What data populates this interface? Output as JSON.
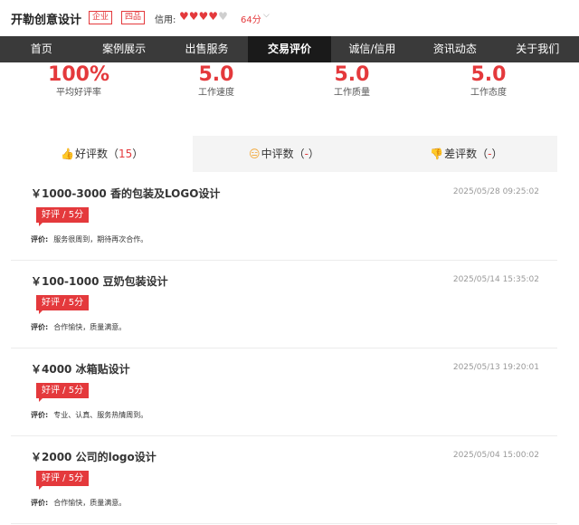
{
  "header": {
    "shop_name": "开勒创意设计",
    "tags": [
      "企业",
      "四品"
    ],
    "credit_label": "信用:",
    "hearts_on": 4,
    "hearts_total": 5,
    "score": "64分"
  },
  "nav": {
    "items": [
      "首页",
      "案例展示",
      "出售服务",
      "交易评价",
      "诚信/信用",
      "资讯动态",
      "关于我们"
    ],
    "active_index": 3
  },
  "stats": [
    {
      "value": "100%",
      "label": "平均好评率"
    },
    {
      "value": "5.0",
      "label": "工作速度"
    },
    {
      "value": "5.0",
      "label": "工作质量"
    },
    {
      "value": "5.0",
      "label": "工作态度"
    }
  ],
  "tabs": [
    {
      "icon": "thumbs-up-icon",
      "label": "好评数（",
      "count": "15",
      "close": "）"
    },
    {
      "icon": "neutral-face-icon",
      "label": "中评数（",
      "count": "-",
      "close": "）"
    },
    {
      "icon": "thumbs-down-icon",
      "label": "差评数（",
      "count": "-",
      "close": "）"
    }
  ],
  "reviews": [
    {
      "title": "￥1000-3000 香的包装及LOGO设计",
      "date": "2025/05/28 09:25:02",
      "badge": "好评 / 5分",
      "comment_label": "评价:",
      "comment": "服务很周到，期待再次合作。"
    },
    {
      "title": "￥100-1000 豆奶包装设计",
      "date": "2025/05/14 15:35:02",
      "badge": "好评 / 5分",
      "comment_label": "评价:",
      "comment": "合作愉快，质量满意。"
    },
    {
      "title": "￥4000 冰箱贴设计",
      "date": "2025/05/13 19:20:01",
      "badge": "好评 / 5分",
      "comment_label": "评价:",
      "comment": "专业、认真、服务热情周到。"
    },
    {
      "title": "￥2000 公司的logo设计",
      "date": "2025/05/04 15:00:02",
      "badge": "好评 / 5分",
      "comment_label": "评价:",
      "comment": "合作愉快，质量满意。"
    }
  ]
}
